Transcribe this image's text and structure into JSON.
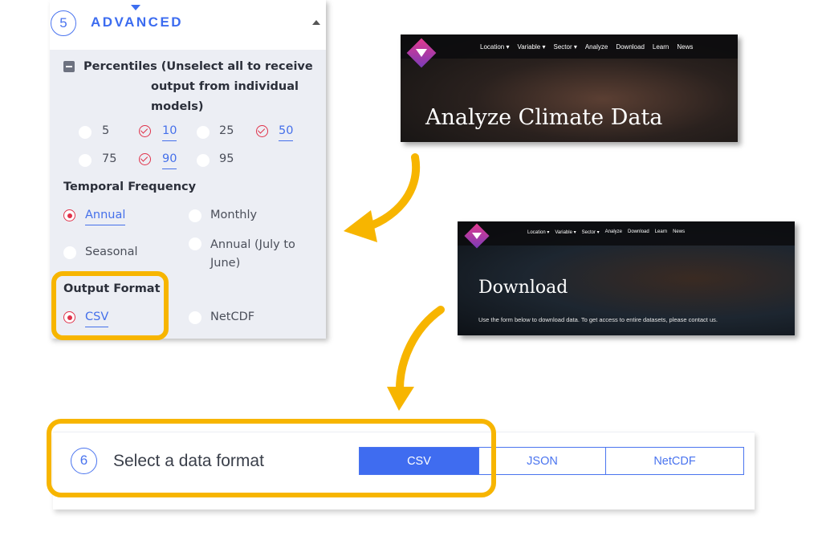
{
  "advanced": {
    "step_number": "5",
    "title": "ADVANCED",
    "percentiles_label_line1": "Percentiles (Unselect all to receive",
    "percentiles_label_line2": "output from individual",
    "percentiles_label_line3": "models)",
    "percentiles": [
      {
        "label": "5",
        "selected": false
      },
      {
        "label": "10",
        "selected": true
      },
      {
        "label": "25",
        "selected": false
      },
      {
        "label": "50",
        "selected": true
      },
      {
        "label": "75",
        "selected": false
      },
      {
        "label": "90",
        "selected": true
      },
      {
        "label": "95",
        "selected": false
      }
    ],
    "temporal_frequency": {
      "heading": "Temporal Frequency",
      "options": [
        {
          "label": "Annual",
          "selected": true
        },
        {
          "label": "Monthly",
          "selected": false
        },
        {
          "label": "Seasonal",
          "selected": false
        },
        {
          "label": "Annual (July to",
          "label2": "June)",
          "selected": false
        }
      ]
    },
    "output_format": {
      "heading": "Output Format",
      "options": [
        {
          "label": "CSV",
          "selected": true
        },
        {
          "label": "NetCDF",
          "selected": false
        }
      ]
    }
  },
  "banner_analyze": {
    "nav": [
      "Location ▾",
      "Variable ▾",
      "Sector ▾",
      "Analyze",
      "Download",
      "Learn",
      "News"
    ],
    "title": "Analyze Climate Data"
  },
  "banner_download": {
    "nav": [
      "Location ▾",
      "Variable ▾",
      "Sector ▾",
      "Analyze",
      "Download",
      "Learn",
      "News"
    ],
    "title": "Download",
    "subtitle": "Use the form below to download data. To get access to entire datasets, please contact us."
  },
  "step6": {
    "step_number": "6",
    "title": "Select a data format",
    "formats": [
      {
        "label": "CSV",
        "active": true
      },
      {
        "label": "JSON",
        "active": false
      },
      {
        "label": "NetCDF",
        "active": false
      }
    ]
  },
  "colors": {
    "accent_blue": "#3f6cf0",
    "highlight_yellow": "#f7b500",
    "selected_red": "#e0324a"
  }
}
